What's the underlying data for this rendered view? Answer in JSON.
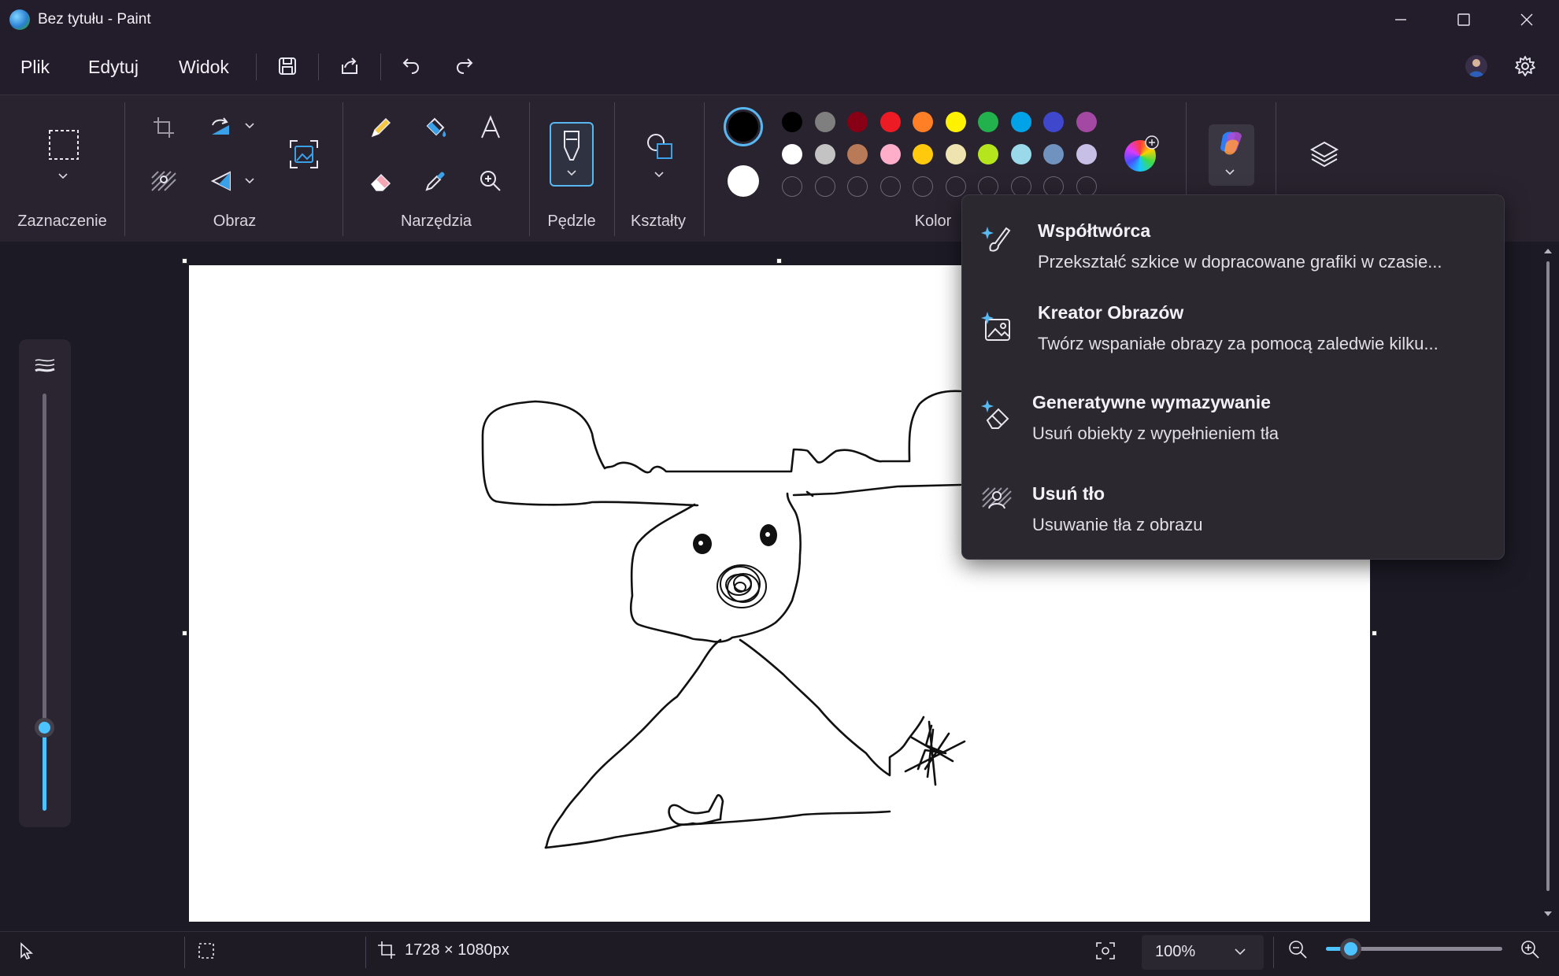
{
  "window": {
    "title": "Bez tytułu - Paint"
  },
  "menu": {
    "items": [
      "Plik",
      "Edytuj",
      "Widok"
    ]
  },
  "ribbon": {
    "groups": {
      "selection": "Zaznaczenie",
      "image": "Obraz",
      "tools": "Narzędzia",
      "brushes": "Pędzle",
      "shapes": "Kształty",
      "colors": "Kolor"
    },
    "colors": {
      "primary": "#000000",
      "secondary": "#ffffff",
      "row1": [
        "#000000",
        "#7f7f7f",
        "#880015",
        "#ed1c24",
        "#ff7f27",
        "#fff200",
        "#22b14c",
        "#00a2e8",
        "#3f48cc",
        "#a349a4"
      ],
      "row2": [
        "#ffffff",
        "#c3c3c3",
        "#b97a57",
        "#ffaec9",
        "#ffc90e",
        "#efe4b0",
        "#b5e61d",
        "#99d9ea",
        "#7092be",
        "#c8bfe7"
      ],
      "row3_empty_count": 10
    }
  },
  "copilot_menu": {
    "items": [
      {
        "title": "Współtwórca",
        "desc": "Przekształć szkice w dopracowane grafiki w czasie...",
        "icon": "brush-sparkle-icon"
      },
      {
        "title": "Kreator Obrazów",
        "desc": "Twórz wspaniałe obrazy za pomocą zaledwie kilku...",
        "icon": "image-sparkle-icon"
      },
      {
        "title": "Generatywne wymazywanie",
        "desc": "Usuń obiekty z wypełnieniem tła",
        "icon": "eraser-sparkle-icon"
      },
      {
        "title": "Usuń tło",
        "desc": "Usuwanie tła z obrazu",
        "icon": "remove-background-icon"
      }
    ]
  },
  "brush_size": {
    "level": 0.2
  },
  "status": {
    "canvas_size": "1728 × 1080px",
    "zoom": "100%",
    "zoom_slider_level": 0.14
  }
}
